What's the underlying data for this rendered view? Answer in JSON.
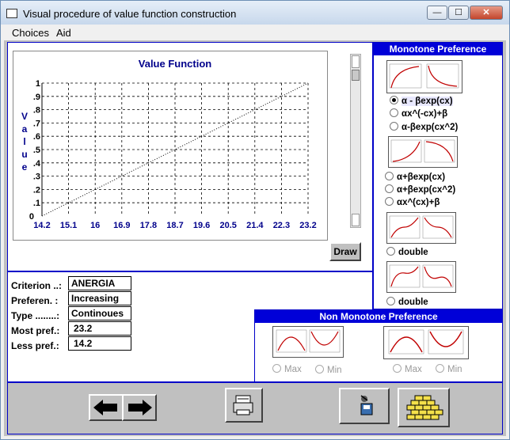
{
  "window": {
    "title": "Visual procedure of value function construction",
    "controls": {
      "minimize": "—",
      "maximize": "☐",
      "close": "✕"
    }
  },
  "menu": {
    "items": [
      "Choices",
      "Aid"
    ]
  },
  "chart_data": {
    "type": "line",
    "title": "Value Function",
    "ylabel": "Value",
    "x_tick_labels": [
      "14.2",
      "15.1",
      "16",
      "16.9",
      "17.8",
      "18.7",
      "19.6",
      "20.5",
      "21.4",
      "22.3",
      "23.2"
    ],
    "y_tick_labels": [
      "0",
      ".1",
      ".2",
      ".3",
      ".4",
      ".5",
      ".6",
      ".7",
      ".8",
      ".9",
      "1"
    ],
    "xlim": [
      14.2,
      23.2
    ],
    "ylim": [
      0,
      1
    ],
    "grid": true,
    "series": [
      {
        "x": [
          14.2,
          23.2
        ],
        "y": [
          0,
          1
        ],
        "style": "dotted",
        "color": "#000000"
      }
    ]
  },
  "draw_button": "Draw",
  "criterion": {
    "labels": {
      "criterion": "Criterion ..:",
      "preference": "Preferen. :",
      "type": "Type ........:",
      "most": "Most pref.:",
      "less": "Less pref.:"
    },
    "values": {
      "criterion": "ANERGIA",
      "preference": "Increasing",
      "type": "Continoues",
      "most": "23.2",
      "less": "14.2"
    }
  },
  "monotone": {
    "title": "Monotone Preference",
    "options": [
      "α - βexp(cx)",
      "αx^(-cx)+β",
      "α-βexp(cx^2)",
      "α+βexp(cx)",
      "α+βexp(cx^2)",
      "αx^(cx)+β",
      "double",
      "double"
    ],
    "selected_index": 0
  },
  "non_monotone": {
    "title": "Non Monotone Preference",
    "options": [
      "Max",
      "Min",
      "Max",
      "Min"
    ]
  },
  "toolbar": {
    "icons": [
      "back-arrow-icon",
      "forward-arrow-icon",
      "printer-icon",
      "disk-export-icon",
      "wall-icon"
    ]
  }
}
